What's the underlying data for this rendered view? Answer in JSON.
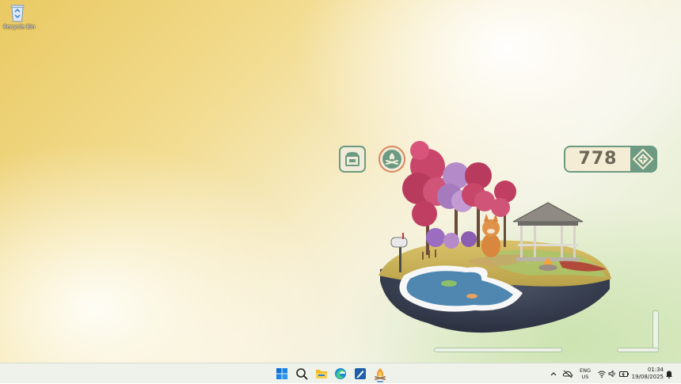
{
  "desktop": {
    "recycle_bin": {
      "label": "Recycle Bin",
      "icon": "recycle-bin-icon"
    }
  },
  "game": {
    "buttons": [
      {
        "name": "shop-button",
        "icon": "shop-icon"
      },
      {
        "name": "campfire-button",
        "icon": "campfire-icon"
      }
    ],
    "currency": {
      "amount": "778",
      "icon": "gem-icon"
    },
    "colors": {
      "accent": "#6d9a82",
      "panel": "#f4ecd5",
      "text": "#6b6655"
    }
  },
  "taskbar": {
    "icons": [
      {
        "name": "start-button",
        "icon": "windows-logo-icon"
      },
      {
        "name": "search-button",
        "icon": "search-icon"
      },
      {
        "name": "file-explorer-button",
        "icon": "folder-icon"
      },
      {
        "name": "edge-button",
        "icon": "edge-icon"
      },
      {
        "name": "pen-app-button",
        "icon": "pen-app-icon"
      },
      {
        "name": "game-app-button",
        "icon": "campfire-app-icon"
      }
    ],
    "tray": {
      "language": "ENG",
      "region": "US",
      "time": "01:34",
      "date": "19/08/2025"
    }
  }
}
